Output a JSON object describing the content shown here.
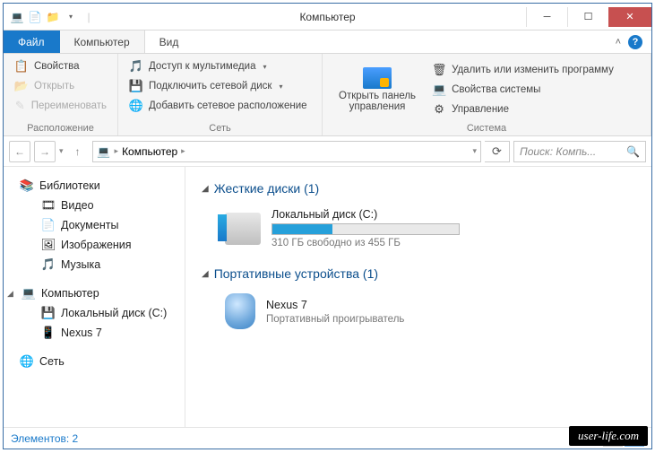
{
  "title": "Компьютер",
  "tabs": {
    "file": "Файл",
    "computer": "Компьютер",
    "view": "Вид"
  },
  "ribbon": {
    "location": {
      "label": "Расположение",
      "properties": "Свойства",
      "open": "Открыть",
      "rename": "Переименовать"
    },
    "network": {
      "label": "Сеть",
      "media_access": "Доступ к мультимедиа",
      "map_drive": "Подключить сетевой диск",
      "add_location": "Добавить сетевое расположение"
    },
    "control": {
      "open_panel_line1": "Открыть панель",
      "open_panel_line2": "управления"
    },
    "system": {
      "label": "Система",
      "uninstall": "Удалить или изменить программу",
      "sys_props": "Свойства системы",
      "manage": "Управление"
    }
  },
  "breadcrumb": {
    "item": "Компьютер"
  },
  "search": {
    "placeholder": "Поиск: Компь..."
  },
  "sidebar": {
    "libraries": "Библиотеки",
    "video": "Видео",
    "documents": "Документы",
    "pictures": "Изображения",
    "music": "Музыка",
    "computer": "Компьютер",
    "local_disk": "Локальный диск (C:)",
    "nexus": "Nexus 7",
    "network": "Сеть"
  },
  "content": {
    "hdd_group": "Жесткие диски (1)",
    "portable_group": "Портативные устройства (1)",
    "local_disk": {
      "name": "Локальный диск (C:)",
      "free_text": "310 ГБ свободно из 455 ГБ",
      "fill_percent": 32
    },
    "nexus": {
      "name": "Nexus 7",
      "type": "Портативный проигрыватель"
    }
  },
  "status": {
    "items": "Элементов: 2"
  },
  "watermark": "user-life.com"
}
